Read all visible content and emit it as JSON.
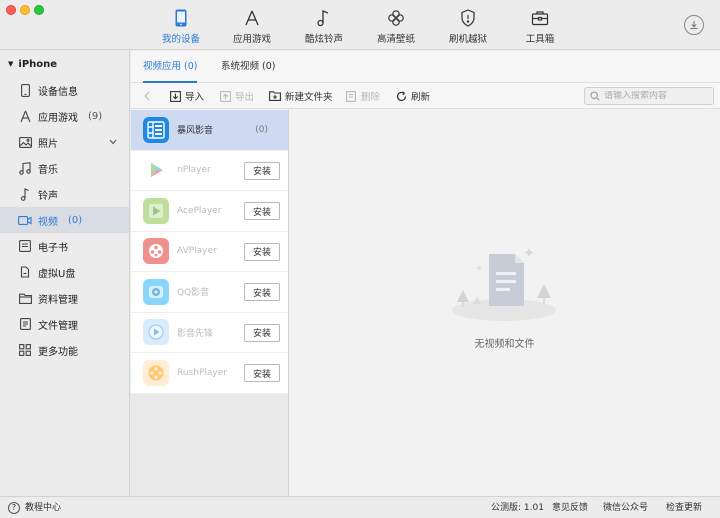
{
  "nav": {
    "tabs": [
      {
        "label": "我的设备",
        "icon": "phone-icon",
        "active": true
      },
      {
        "label": "应用游戏",
        "icon": "app-store-icon"
      },
      {
        "label": "酷炫铃声",
        "icon": "music-note-icon"
      },
      {
        "label": "高清壁纸",
        "icon": "flower-icon"
      },
      {
        "label": "刷机越狱",
        "icon": "shield-icon"
      },
      {
        "label": "工具箱",
        "icon": "toolbox-icon"
      }
    ]
  },
  "sidebar": {
    "device_name": "iPhone",
    "items": [
      {
        "label": "设备信息",
        "icon": "phone-icon"
      },
      {
        "label": "应用游戏",
        "count": "(9)",
        "icon": "app-store-icon"
      },
      {
        "label": "照片",
        "icon": "photo-icon"
      },
      {
        "label": "音乐",
        "icon": "music-icon"
      },
      {
        "label": "铃声",
        "icon": "bell-note-icon"
      },
      {
        "label": "视频",
        "count": "(0)",
        "icon": "video-icon",
        "active": true
      },
      {
        "label": "电子书",
        "icon": "book-icon"
      },
      {
        "label": "虚拟U盘",
        "icon": "usb-drive-icon"
      },
      {
        "label": "资料管理",
        "icon": "folder-icon"
      },
      {
        "label": "文件管理",
        "icon": "file-icon"
      },
      {
        "label": "更多功能",
        "icon": "grid-icon"
      }
    ]
  },
  "subtabs": [
    {
      "label": "视频应用 (0)",
      "active": true
    },
    {
      "label": "系统视频 (0)"
    }
  ],
  "toolbar": {
    "import": "导入",
    "export": "导出",
    "new_folder": "新建文件夹",
    "delete": "删除",
    "refresh": "刷新",
    "search_placeholder": "请输入搜索内容"
  },
  "apps": [
    {
      "name": "暴风影音",
      "count": "(0)",
      "active": true,
      "color": "#1e88e5"
    },
    {
      "name": "nPlayer",
      "install": "安装",
      "color": "#ffffff"
    },
    {
      "name": "AcePlayer",
      "install": "安装",
      "color": "#8bc34a"
    },
    {
      "name": "AVPlayer",
      "install": "安装",
      "color": "#e53935"
    },
    {
      "name": "QQ影音",
      "install": "安装",
      "color": "#29b6f6"
    },
    {
      "name": "影音先锋",
      "install": "安装",
      "color": "#64b5f6"
    },
    {
      "name": "RushPlayer",
      "install": "安装",
      "color": "#ff9800"
    }
  ],
  "empty": {
    "text": "无视频和文件"
  },
  "status": {
    "tutorial": "教程中心",
    "version": "公测版: 1.01",
    "feedback": "意见反馈",
    "wechat": "微信公众号",
    "update": "检查更新"
  }
}
